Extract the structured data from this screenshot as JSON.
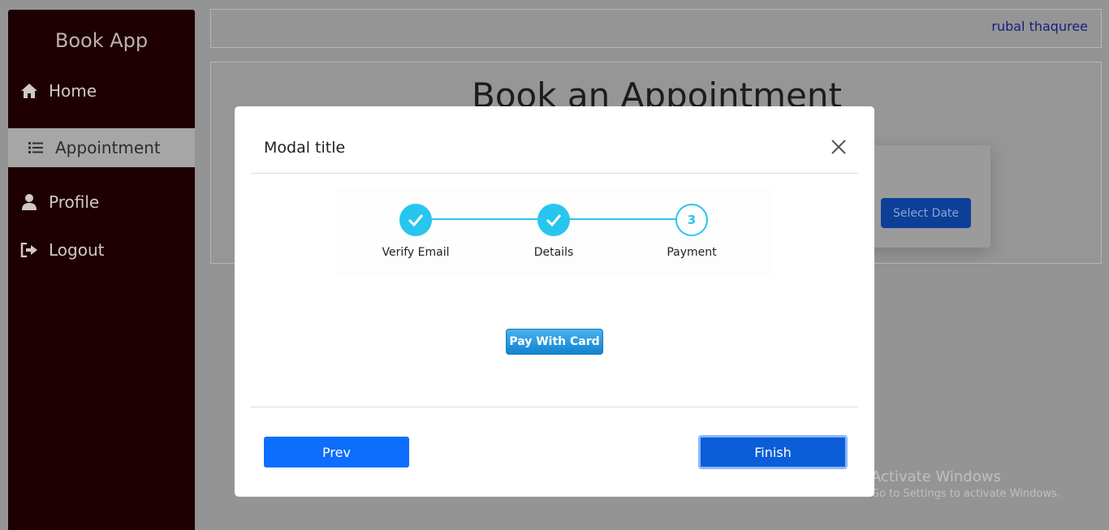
{
  "sidebar": {
    "brand": "Book App",
    "items": [
      {
        "label": "Home",
        "icon": "home-icon"
      },
      {
        "label": "Appointment",
        "icon": "list-icon"
      },
      {
        "label": "Profile",
        "icon": "user-icon"
      },
      {
        "label": "Logout",
        "icon": "logout-icon"
      }
    ],
    "active": "Appointment"
  },
  "header": {
    "user_name": "rubal thaquree"
  },
  "main": {
    "title": "Book an Appointment",
    "select_date_label": "Select Date"
  },
  "modal": {
    "title": "Modal title",
    "steps": [
      {
        "label": "Verify Email",
        "status": "done"
      },
      {
        "label": "Details",
        "status": "done"
      },
      {
        "label": "Payment",
        "status": "current",
        "number": "3"
      }
    ],
    "pay_button_label": "Pay With Card",
    "prev_label": "Prev",
    "finish_label": "Finish"
  },
  "watermark": {
    "title": "Activate Windows",
    "subtitle": "Go to Settings to activate Windows."
  },
  "colors": {
    "sidebar_bg": "#1f0002",
    "accent": "#27c6ee",
    "primary_button": "#0d6efd",
    "user_link": "#14207e"
  }
}
